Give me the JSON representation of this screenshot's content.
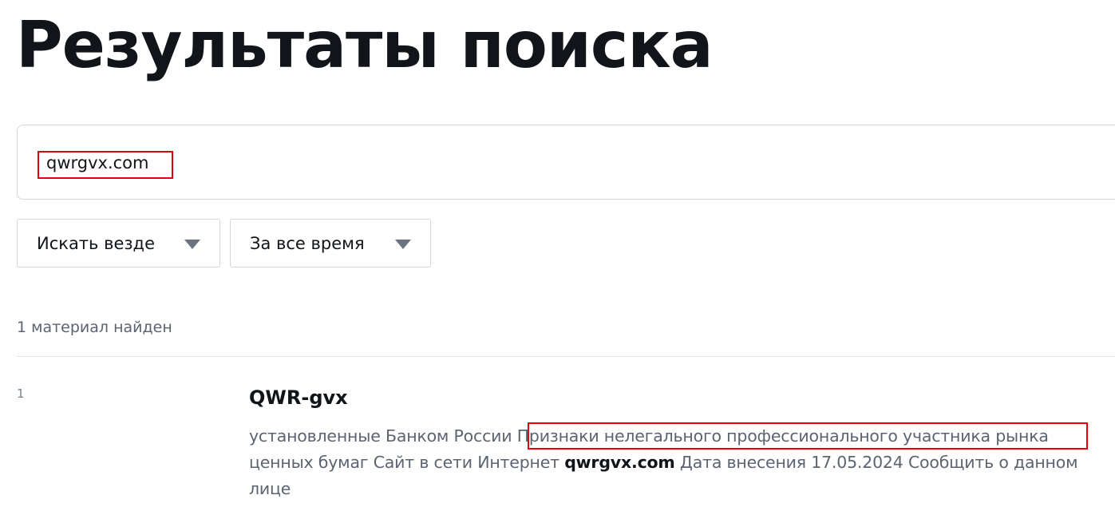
{
  "page": {
    "title": "Результаты поиска"
  },
  "search": {
    "value": "qwrgvx.com"
  },
  "filters": {
    "scope_label": "Искать везде",
    "period_label": "За все время"
  },
  "results": {
    "count_text": "1 материал найден",
    "items": [
      {
        "index": "1",
        "title": "QWR-gvx",
        "snippet_before": "установленные Банком России ",
        "snippet_highlight": "Признаки нелегального профессионального участника рынка",
        "snippet_middle": " ценных бумаг Сайт в сети Интернет ",
        "snippet_bold": "qwrgvx.com",
        "snippet_after": " Дата внесения 17.05.2024 Сообщить о данном лице"
      }
    ]
  },
  "colors": {
    "annotation_border": "#e0000b",
    "muted_text": "#5b6470",
    "primary_text": "#111418"
  },
  "icons": {
    "dropdown": "chevron-down-icon"
  }
}
